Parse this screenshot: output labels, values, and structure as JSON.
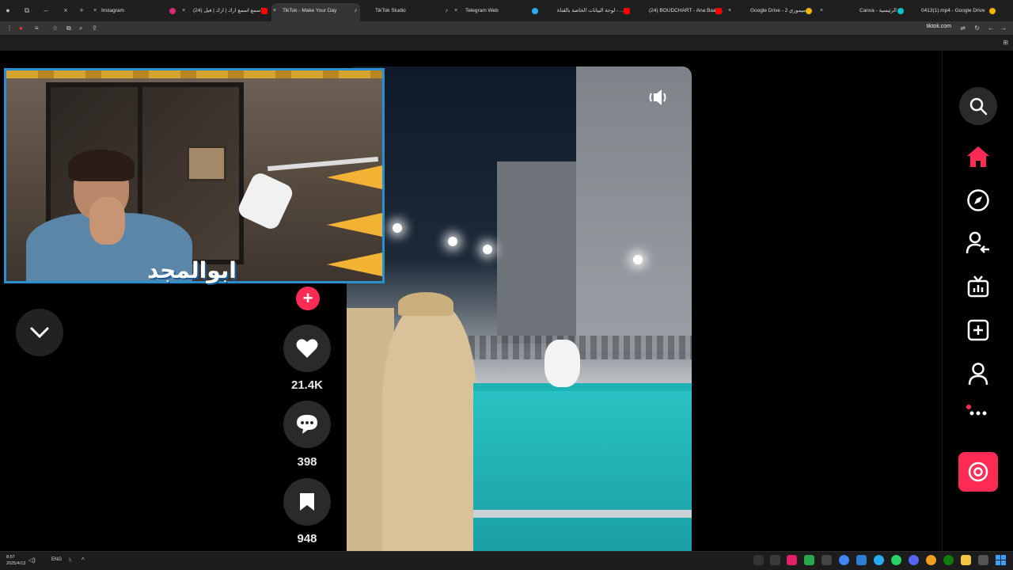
{
  "browser": {
    "tabs": [
      {
        "label": "Instagram",
        "active": false,
        "favicon_color": "#d62976"
      },
      {
        "label": "(24) اسمع اسمع ارك | ارك | فيل...",
        "active": false,
        "favicon_color": "#ff0000"
      },
      {
        "label": "TikTok - Make Your Day",
        "active": true,
        "favicon_color": "#ffffff"
      },
      {
        "label": "TikTok Studio",
        "active": false,
        "favicon_color": "#ffffff"
      },
      {
        "label": "Telegram Web",
        "active": false,
        "favicon_color": "#2aabee"
      },
      {
        "label": "لوحة البيانات الخاصة بالقناة - ...",
        "active": false,
        "favicon_color": "#ff0000"
      },
      {
        "label": "(24) BOUDCHART - Ana Baas...",
        "active": false,
        "favicon_color": "#ff0000"
      },
      {
        "label": "Google Drive - 2 ميموري",
        "active": false,
        "favicon_color": "#f4b400"
      },
      {
        "label": "Canva - الرئيسية",
        "active": false,
        "favicon_color": "#00c4cc"
      },
      {
        "label": "0413(1).mp4 - Google Drive",
        "active": false,
        "favicon_color": "#f4b400"
      }
    ],
    "new_tab": "+",
    "address": "tiktok.com"
  },
  "video": {
    "sound_icon": "sound-on-icon",
    "streamer_logo": "ابوالمجد"
  },
  "actions": {
    "likes": "21.4K",
    "comments": "398",
    "saves": "948",
    "follow_plus": "+"
  },
  "sidebar": {
    "items": [
      "search",
      "home",
      "explore",
      "following",
      "live",
      "upload",
      "profile",
      "more",
      "profile-action"
    ],
    "accent": "#fe2c55"
  },
  "taskbar": {
    "time": "8:57",
    "date": "2025/4/13",
    "lang": "ENG"
  }
}
